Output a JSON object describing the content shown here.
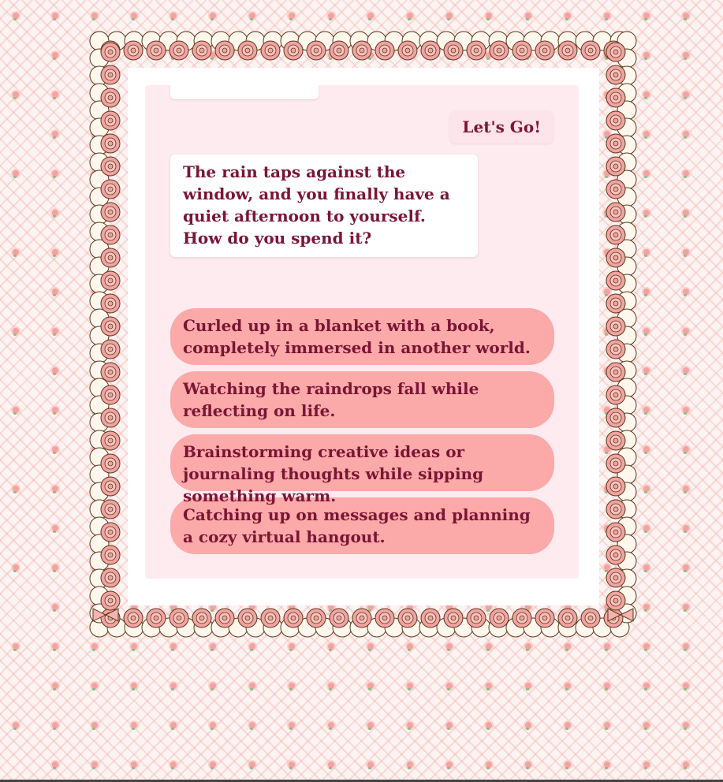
{
  "colors": {
    "page_background": "#fdf3f2",
    "frame_rose": "#f3a3a3",
    "frame_outline": "#5a3a1a",
    "panel_background": "#fdebef",
    "user_bubble": "#fde3ea",
    "option_button": "#fca9a9",
    "text": "#7a1535"
  },
  "chat": {
    "user_message": "Let's Go!",
    "bot_message": "The rain taps against the window, and you finally have a quiet afternoon to yourself. How do you spend it?",
    "options": [
      {
        "label": "Curled up in a blanket with a book, completely immersed in another world."
      },
      {
        "label": "Watching the raindrops fall while reflecting on life."
      },
      {
        "label": "Brainstorming creative ideas or journaling thoughts while sipping something warm."
      },
      {
        "label": "Catching up on messages and planning a cozy virtual hangout."
      }
    ]
  },
  "decor": {
    "frame_icon": "rose-lace-frame-icon",
    "corner_icon": "ribbon-bow-icon",
    "pattern_icon": "small-rose-icon"
  }
}
